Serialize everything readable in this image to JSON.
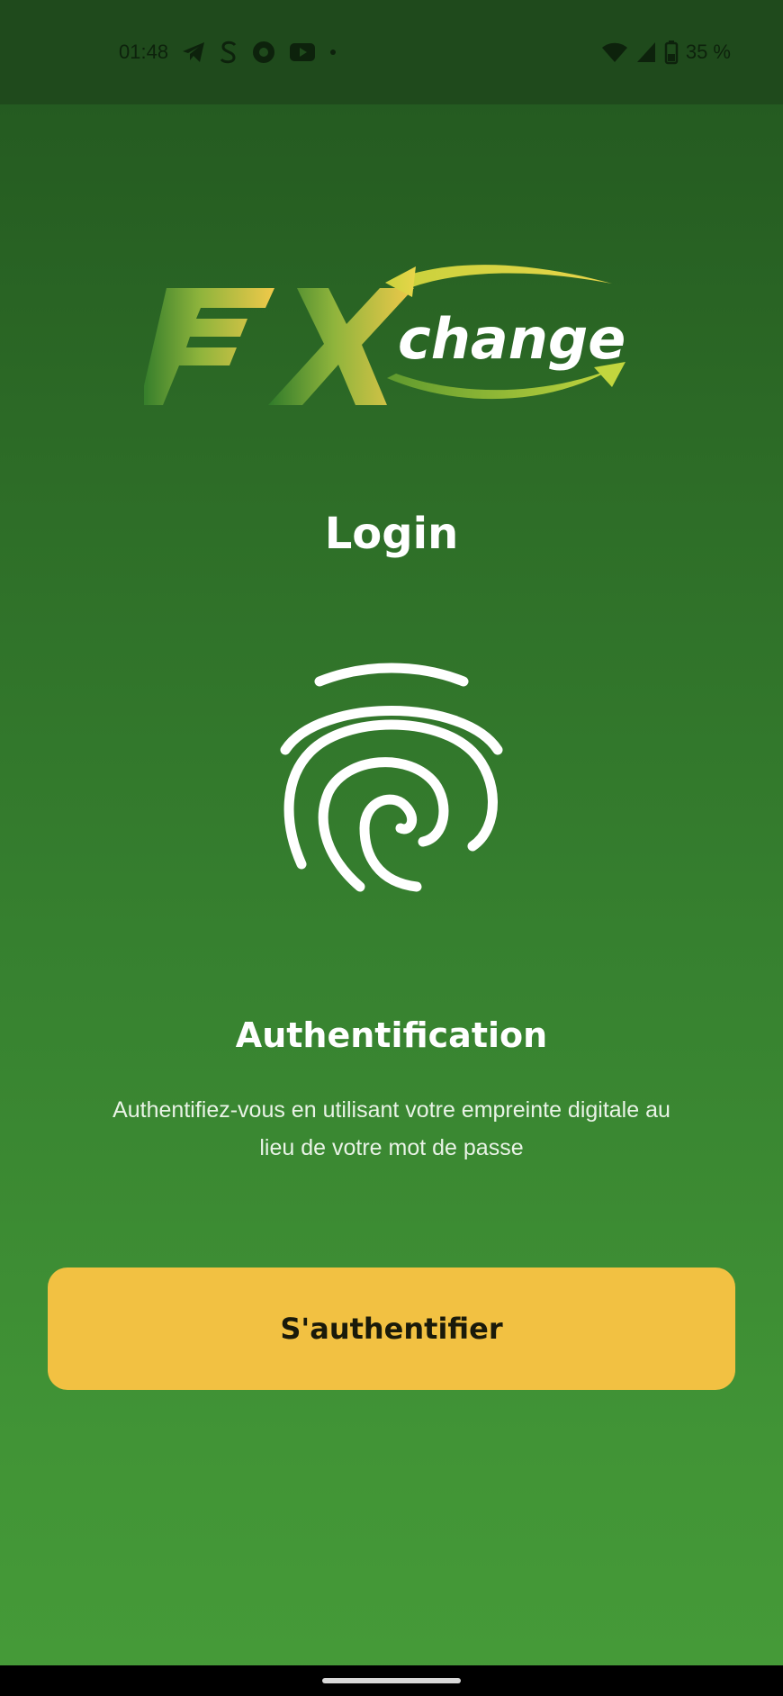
{
  "status_bar": {
    "time": "01:48",
    "battery": "35 %",
    "left_icons": [
      "telegram-icon",
      "s-app-icon",
      "circle-app-icon",
      "youtube-icon",
      "notification-dot-icon"
    ],
    "right_icons": [
      "wifi-icon",
      "cell-signal-icon",
      "battery-icon"
    ]
  },
  "logo": {
    "brand_fx": "FX",
    "brand_change": "change",
    "colors": {
      "fx_dark": "#2f7a2a",
      "fx_light": "#f0c94a",
      "arrow_top": "#d8d23e",
      "arrow_bottom": "#9dc63a"
    }
  },
  "page": {
    "title": "Login"
  },
  "fingerprint": {
    "icon": "fingerprint-icon"
  },
  "auth": {
    "heading": "Authentification",
    "description": "Authentifiez-vous en utilisant votre empreinte digitale au lieu de votre mot de passe",
    "button_label": "S'authentifier"
  },
  "theme": {
    "background_top": "#22561f",
    "background_bottom": "#469b38",
    "button_color": "#f2c142"
  }
}
